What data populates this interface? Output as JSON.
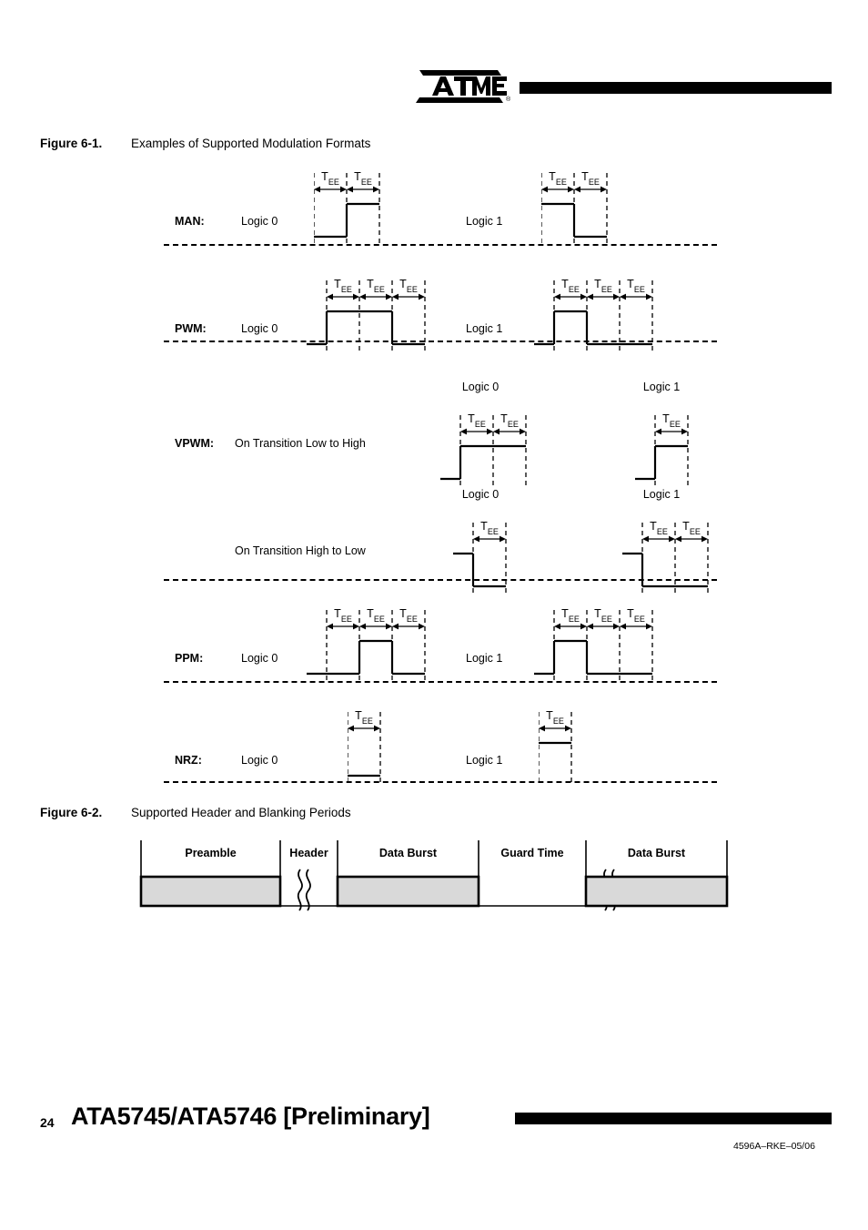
{
  "header": {
    "logo_text": "ATMEL",
    "logo_registered": "®"
  },
  "figure_6_1": {
    "number": "Figure 6-1.",
    "title": "Examples of Supported Modulation Formats",
    "tee_label_base": "T",
    "tee_label_sub": "EE",
    "rows": [
      {
        "name": "man",
        "label": "MAN:",
        "sublabel": "",
        "left": {
          "logic": "Logic 0",
          "segments": 2,
          "levels": [
            0,
            1
          ],
          "lead_in": false
        },
        "right": {
          "logic": "Logic 1",
          "segments": 2,
          "levels": [
            1,
            0
          ],
          "lead_in": false
        }
      },
      {
        "name": "pwm",
        "label": "PWM:",
        "sublabel": "",
        "left": {
          "logic": "Logic 0",
          "segments": 3,
          "levels": [
            1,
            1,
            0
          ],
          "lead_in": true
        },
        "right": {
          "logic": "Logic 1",
          "segments": 3,
          "levels": [
            1,
            0,
            0
          ],
          "lead_in": true
        }
      },
      {
        "name": "vpwm-low-to-high",
        "label": "VPWM:",
        "sublabel": "On Transition Low to High",
        "left": {
          "logic": "Logic 0",
          "segments": 2,
          "levels": [
            1,
            1
          ],
          "lead_in": true
        },
        "right": {
          "logic": "Logic 1",
          "segments": 1,
          "levels": [
            1
          ],
          "lead_in": true
        }
      },
      {
        "name": "vpwm-high-to-low",
        "label": "",
        "sublabel": "On Transition High to Low",
        "left": {
          "logic": "Logic 0",
          "segments": 1,
          "levels": [
            0
          ],
          "lead_in": true,
          "lead_level": 1
        },
        "right": {
          "logic": "Logic 1",
          "segments": 2,
          "levels": [
            0,
            0
          ],
          "lead_in": true,
          "lead_level": 1
        }
      },
      {
        "name": "ppm",
        "label": "PPM:",
        "sublabel": "",
        "left": {
          "logic": "Logic 0",
          "segments": 3,
          "levels": [
            0,
            1,
            0
          ],
          "lead_in": true
        },
        "right": {
          "logic": "Logic 1",
          "segments": 3,
          "levels": [
            1,
            0,
            0
          ],
          "lead_in": true
        }
      },
      {
        "name": "nrz",
        "label": "NRZ:",
        "sublabel": "",
        "left": {
          "logic": "Logic 0",
          "segments": 1,
          "levels": [
            0
          ],
          "lead_in": false
        },
        "right": {
          "logic": "Logic 1",
          "segments": 1,
          "levels": [
            1
          ],
          "lead_in": false
        }
      }
    ]
  },
  "figure_6_2": {
    "number": "Figure 6-2.",
    "title": "Supported Header and Blanking Periods",
    "fill_color": "#d9d9d9",
    "segments": [
      {
        "label": "Preamble",
        "filled": true,
        "break_after": true
      },
      {
        "label": "Header",
        "filled": false,
        "break_after": false
      },
      {
        "label": "Data Burst",
        "filled": true,
        "break_after": false
      },
      {
        "label": "Guard Time",
        "filled": false,
        "break_after": true
      },
      {
        "label": "Data Burst",
        "filled": true,
        "break_after": false
      }
    ]
  },
  "footer": {
    "page_number": "24",
    "document_title": "ATA5745/ATA5746 [Preliminary]",
    "document_code": "4596A–RKE–05/06"
  }
}
